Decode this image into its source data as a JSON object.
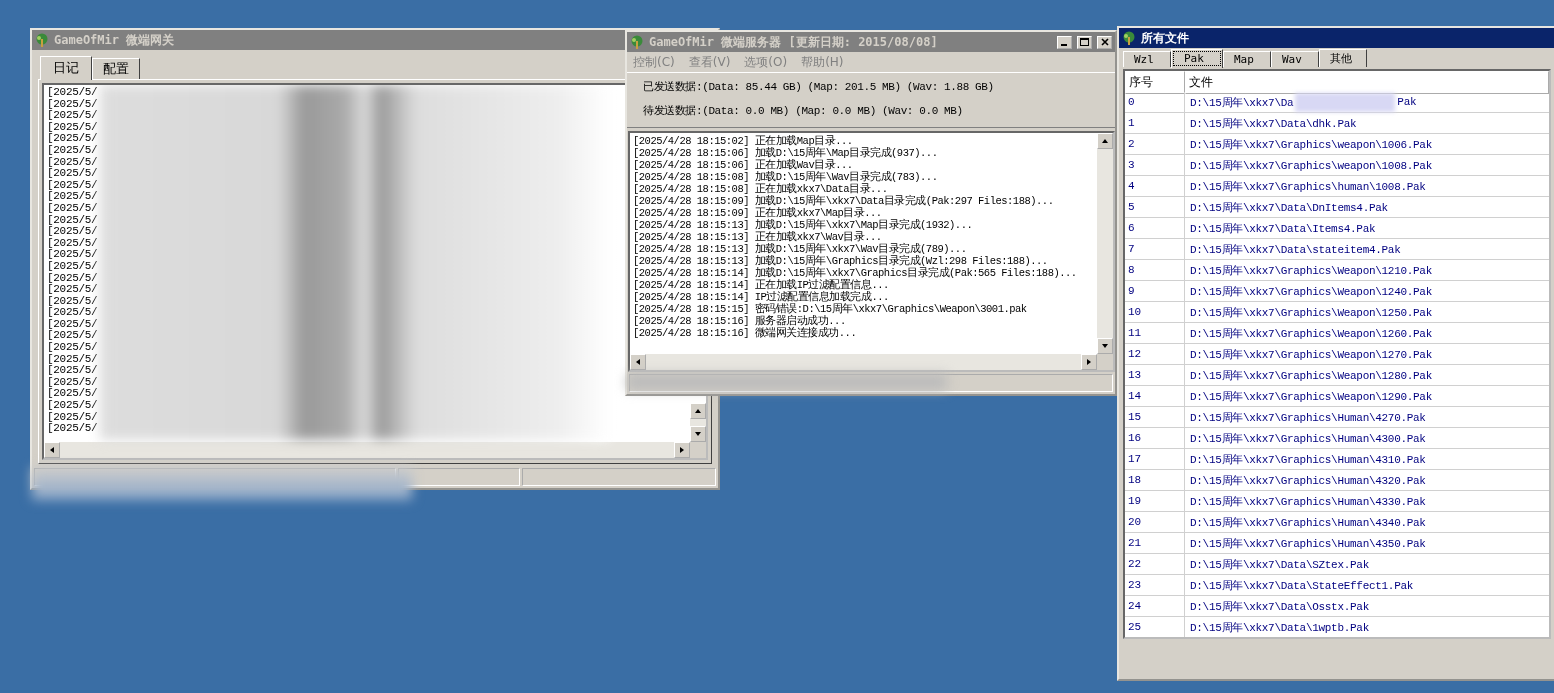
{
  "gateway_window": {
    "title": "GameOfMir 微端网关",
    "active": false,
    "tabs": [
      {
        "label": "日记",
        "selected": true
      },
      {
        "label": "配置",
        "selected": false
      }
    ],
    "log": [
      "[2025/5/",
      "[2025/5/",
      "[2025/5/",
      "[2025/5/",
      "[2025/5/",
      "[2025/5/",
      "[2025/5/",
      "[2025/5/",
      "[2025/5/",
      "[2025/5/",
      "[2025/5/",
      "[2025/5/",
      "[2025/5/",
      "[2025/5/",
      "[2025/5/",
      "[2025/5/",
      "[2025/5/",
      "[2025/5/",
      "[2025/5/",
      "[2025/5/",
      "[2025/5/",
      "[2025/5/",
      "[2025/5/",
      "[2025/5/",
      "[2025/5/",
      "[2025/5/",
      "[2025/5/",
      "[2025/5/",
      "[2025/5/",
      "[2025/5/"
    ]
  },
  "server_window": {
    "title": "GameOfMir 微端服务器 [更新日期: 2015/08/08]",
    "active": false,
    "menu": [
      "控制(C)",
      "查看(V)",
      "选项(O)",
      "帮助(H)"
    ],
    "stats": [
      "已发送数据:(Data: 85.44 GB) (Map: 201.5 MB) (Wav: 1.88 GB)",
      "待发送数据:(Data: 0.0 MB) (Map: 0.0 MB) (Wav: 0.0 MB)"
    ],
    "log": [
      "[2025/4/28 18:15:02] 正在加载Map目录...",
      "[2025/4/28 18:15:06] 加载D:\\15周年\\Map目录完成(937)...",
      "[2025/4/28 18:15:06] 正在加载Wav目录...",
      "[2025/4/28 18:15:08] 加载D:\\15周年\\Wav目录完成(783)...",
      "[2025/4/28 18:15:08] 正在加载xkx7\\Data目录...",
      "[2025/4/28 18:15:09] 加载D:\\15周年\\xkx7\\Data目录完成(Pak:297 Files:188)...",
      "[2025/4/28 18:15:09] 正在加载xkx7\\Map目录...",
      "[2025/4/28 18:15:13] 加载D:\\15周年\\xkx7\\Map目录完成(1932)...",
      "[2025/4/28 18:15:13] 正在加载xkx7\\Wav目录...",
      "[2025/4/28 18:15:13] 加载D:\\15周年\\xkx7\\Wav目录完成(789)...",
      "[2025/4/28 18:15:13] 加载D:\\15周年\\Graphics目录完成(Wzl:298 Files:188)...",
      "[2025/4/28 18:15:14] 加载D:\\15周年\\xkx7\\Graphics目录完成(Pak:565 Files:188)...",
      "[2025/4/28 18:15:14] 正在加载IP过滤配置信息...",
      "[2025/4/28 18:15:14] IP过滤配置信息加载完成...",
      "[2025/4/28 18:15:15] 密码错误:D:\\15周年\\xkx7\\Graphics\\Weapon\\3001.pak",
      "[2025/4/28 18:15:16] 服务器启动成功...",
      "[2025/4/28 18:15:16] 微端网关连接成功..."
    ]
  },
  "files_window": {
    "title": "所有文件",
    "active": true,
    "tabs": [
      {
        "label": "Wzl",
        "selected": false
      },
      {
        "label": "Pak",
        "selected": true
      },
      {
        "label": "Map",
        "selected": false
      },
      {
        "label": "Wav",
        "selected": false
      },
      {
        "label": "其他",
        "selected": false
      }
    ],
    "columns": [
      "序号",
      "文件"
    ],
    "rows": [
      {
        "index": "0",
        "file": "D:\\15周年\\xkx7\\Da",
        "file_end": "Pak"
      },
      {
        "index": "1",
        "file": "D:\\15周年\\xkx7\\Data\\dhk.Pak"
      },
      {
        "index": "2",
        "file": "D:\\15周年\\xkx7\\Graphics\\weapon\\1006.Pak"
      },
      {
        "index": "3",
        "file": "D:\\15周年\\xkx7\\Graphics\\weapon\\1008.Pak"
      },
      {
        "index": "4",
        "file": "D:\\15周年\\xkx7\\Graphics\\human\\1008.Pak"
      },
      {
        "index": "5",
        "file": "D:\\15周年\\xkx7\\Data\\DnItems4.Pak"
      },
      {
        "index": "6",
        "file": "D:\\15周年\\xkx7\\Data\\Items4.Pak"
      },
      {
        "index": "7",
        "file": "D:\\15周年\\xkx7\\Data\\stateitem4.Pak"
      },
      {
        "index": "8",
        "file": "D:\\15周年\\xkx7\\Graphics\\Weapon\\1210.Pak"
      },
      {
        "index": "9",
        "file": "D:\\15周年\\xkx7\\Graphics\\Weapon\\1240.Pak"
      },
      {
        "index": "10",
        "file": "D:\\15周年\\xkx7\\Graphics\\Weapon\\1250.Pak"
      },
      {
        "index": "11",
        "file": "D:\\15周年\\xkx7\\Graphics\\Weapon\\1260.Pak"
      },
      {
        "index": "12",
        "file": "D:\\15周年\\xkx7\\Graphics\\Weapon\\1270.Pak"
      },
      {
        "index": "13",
        "file": "D:\\15周年\\xkx7\\Graphics\\Weapon\\1280.Pak"
      },
      {
        "index": "14",
        "file": "D:\\15周年\\xkx7\\Graphics\\Weapon\\1290.Pak"
      },
      {
        "index": "15",
        "file": "D:\\15周年\\xkx7\\Graphics\\Human\\4270.Pak"
      },
      {
        "index": "16",
        "file": "D:\\15周年\\xkx7\\Graphics\\Human\\4300.Pak"
      },
      {
        "index": "17",
        "file": "D:\\15周年\\xkx7\\Graphics\\Human\\4310.Pak"
      },
      {
        "index": "18",
        "file": "D:\\15周年\\xkx7\\Graphics\\Human\\4320.Pak"
      },
      {
        "index": "19",
        "file": "D:\\15周年\\xkx7\\Graphics\\Human\\4330.Pak"
      },
      {
        "index": "20",
        "file": "D:\\15周年\\xkx7\\Graphics\\Human\\4340.Pak"
      },
      {
        "index": "21",
        "file": "D:\\15周年\\xkx7\\Graphics\\Human\\4350.Pak"
      },
      {
        "index": "22",
        "file": "D:\\15周年\\xkx7\\Data\\SZtex.Pak"
      },
      {
        "index": "23",
        "file": "D:\\15周年\\xkx7\\Data\\StateEffect1.Pak"
      },
      {
        "index": "24",
        "file": "D:\\15周年\\xkx7\\Data\\Osstx.Pak"
      },
      {
        "index": "25",
        "file": "D:\\15周年\\xkx7\\Data\\1wptb.Pak"
      }
    ]
  }
}
